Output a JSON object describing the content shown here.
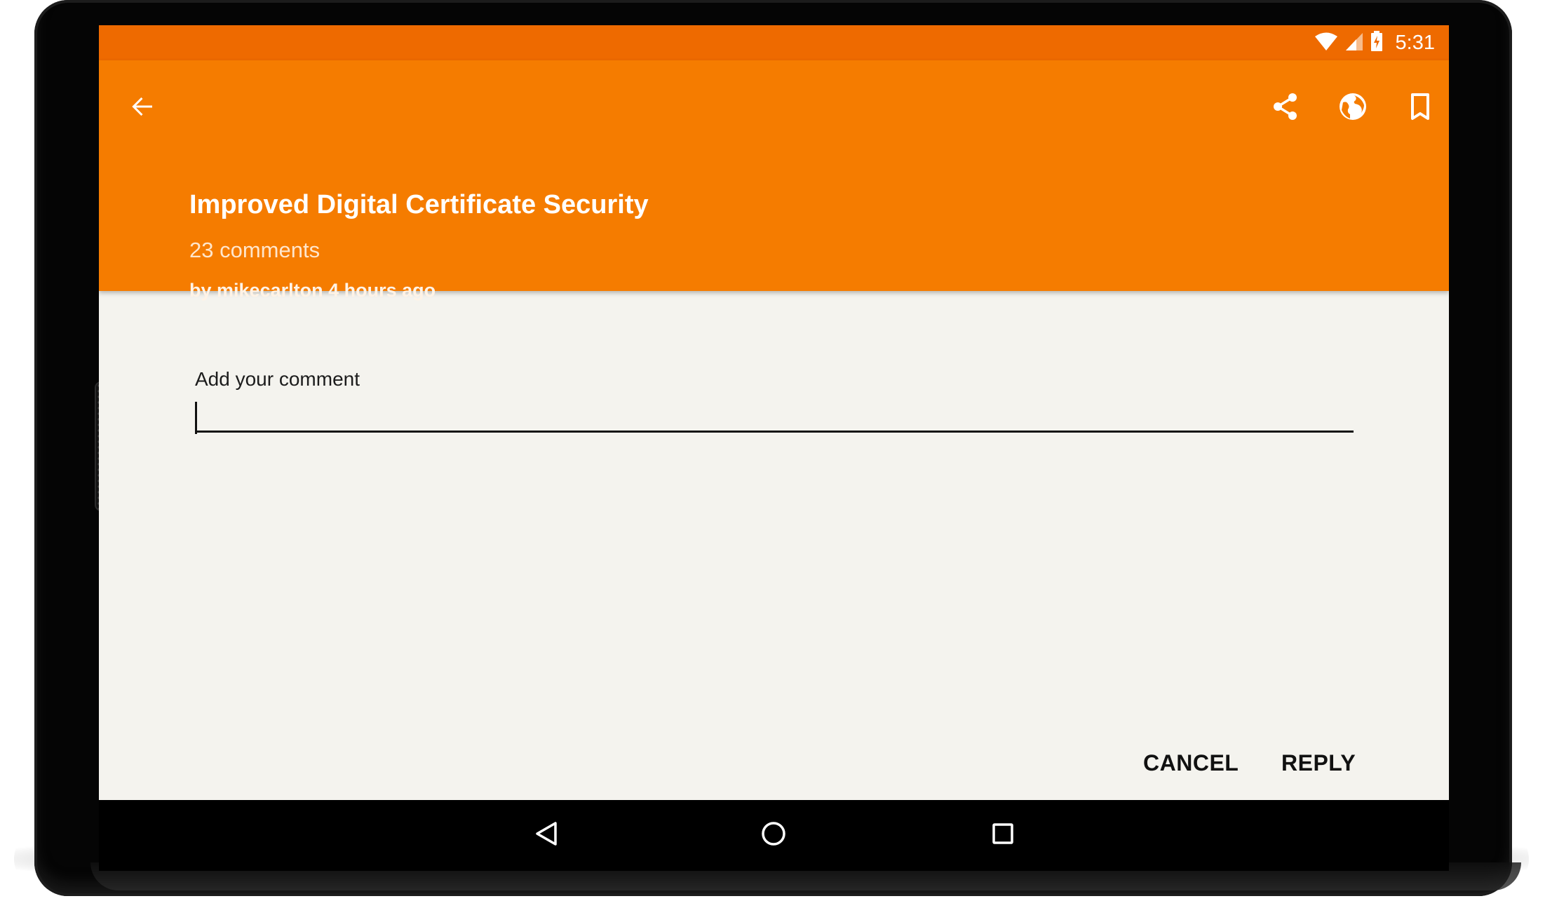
{
  "status_bar": {
    "time": "5:31",
    "icons": [
      "wifi-icon",
      "signal-icon",
      "battery-charging-icon"
    ]
  },
  "app_bar": {
    "icons": {
      "back": "arrow-back-icon",
      "share": "share-icon",
      "open_in_browser": "globe-icon",
      "bookmark": "bookmark-icon"
    },
    "title": "Improved Digital Certificate Security",
    "comments": "23 comments",
    "byline": "by mikecarlton 4 hours ago"
  },
  "comment_form": {
    "label": "Add your comment",
    "value": "",
    "cancel_label": "CANCEL",
    "reply_label": "REPLY"
  },
  "nav_bar": {
    "icons": [
      "nav-back-icon",
      "nav-home-icon",
      "nav-recents-icon"
    ]
  },
  "colors": {
    "status_bar": "#ee6a00",
    "app_bar": "#f57c00",
    "content_background": "#f4f3ee"
  }
}
